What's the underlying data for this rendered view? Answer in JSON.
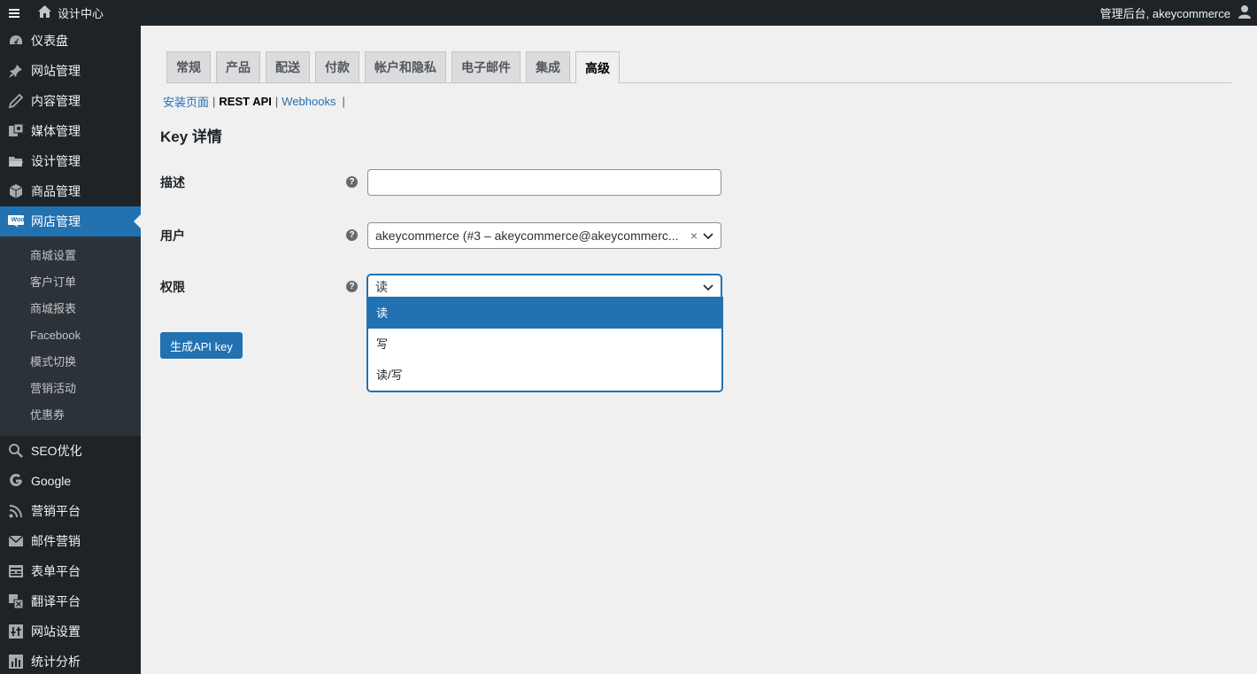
{
  "adminbar": {
    "site_name": "设计中心",
    "greeting": "管理后台, akeycommerce"
  },
  "sidebar": {
    "items": [
      {
        "label": "仪表盘",
        "icon": "dashboard-icon"
      },
      {
        "label": "网站管理",
        "icon": "pin-icon"
      },
      {
        "label": "内容管理",
        "icon": "pencil-icon"
      },
      {
        "label": "媒体管理",
        "icon": "media-icon"
      },
      {
        "label": "设计管理",
        "icon": "folder-icon"
      },
      {
        "label": "商品管理",
        "icon": "box-icon"
      },
      {
        "label": "网店管理",
        "icon": "woo-icon"
      }
    ],
    "woo_badge": "Woo",
    "submenu": [
      "商城设置",
      "客户订单",
      "商城报表",
      "Facebook",
      "模式切换",
      "营销活动",
      "优惠券"
    ],
    "items_after": [
      {
        "label": "SEO优化",
        "icon": "search-icon"
      },
      {
        "label": "Google",
        "icon": "google-icon"
      },
      {
        "label": "营销平台",
        "icon": "rss-icon"
      },
      {
        "label": "邮件营销",
        "icon": "mail-icon"
      },
      {
        "label": "表单平台",
        "icon": "form-icon"
      },
      {
        "label": "翻译平台",
        "icon": "translate-icon"
      },
      {
        "label": "网站设置",
        "icon": "settings-icon"
      },
      {
        "label": "统计分析",
        "icon": "chart-icon"
      }
    ]
  },
  "tabs": [
    "常规",
    "产品",
    "配送",
    "付款",
    "帐户和隐私",
    "电子邮件",
    "集成",
    "高级"
  ],
  "subsub": {
    "link1": "安装页面",
    "current": "REST API",
    "link2": "Webhooks",
    "sep": "|"
  },
  "page_title": "Key 详情",
  "form": {
    "description_label": "描述",
    "description_value": "",
    "user_label": "用户",
    "user_value": "akeycommerce (#3 – akeycommerce@akeycommerc...",
    "user_clear": "×",
    "permission_label": "权限",
    "permission_value": "读",
    "help": "?",
    "permission_options": [
      "读",
      "写",
      "读/写"
    ]
  },
  "generate_button": "生成API key",
  "colors": {
    "accent": "#2271b1",
    "sidebar_bg": "#1d2327",
    "submenu_bg": "#2c3338",
    "page_bg": "#f0f0f1"
  }
}
